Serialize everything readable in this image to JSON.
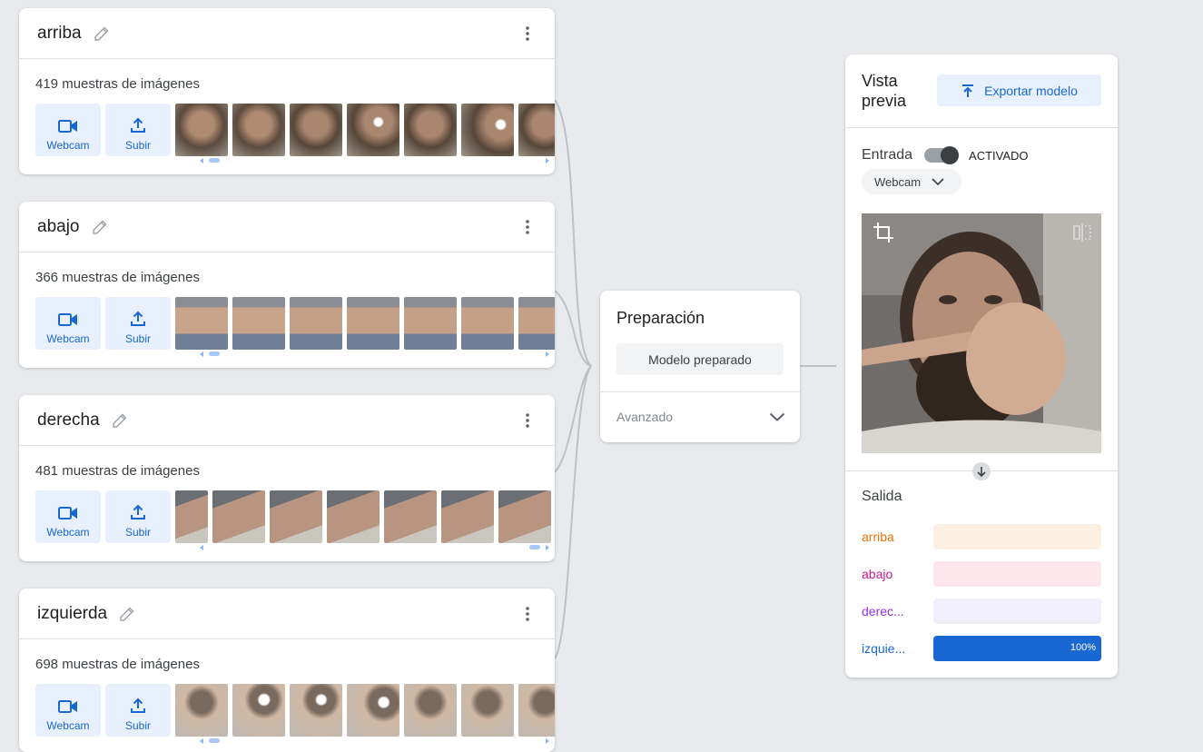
{
  "classes": [
    {
      "title": "arriba",
      "count_text": "419 muestras de imágenes",
      "webcam_label": "Webcam",
      "upload_label": "Subir",
      "scroll_fraction": 0
    },
    {
      "title": "abajo",
      "count_text": "366 muestras de imágenes",
      "webcam_label": "Webcam",
      "upload_label": "Subir",
      "scroll_fraction": 0
    },
    {
      "title": "derecha",
      "count_text": "481 muestras de imágenes",
      "webcam_label": "Webcam",
      "upload_label": "Subir",
      "scroll_fraction": 1
    },
    {
      "title": "izquierda",
      "count_text": "698 muestras de imágenes",
      "webcam_label": "Webcam",
      "upload_label": "Subir",
      "scroll_fraction": 0
    }
  ],
  "training": {
    "title": "Preparación",
    "button_label": "Modelo preparado",
    "advanced_label": "Avanzado"
  },
  "preview": {
    "title": "Vista previa",
    "export_label": "Exportar modelo",
    "input_label": "Entrada",
    "toggle_state": "ACTIVADO",
    "source_select": "Webcam",
    "output_label": "Salida",
    "outputs": [
      {
        "label": "arriba",
        "value": 0,
        "color": "#e8710a",
        "track": "#feefe3",
        "pct_text": ""
      },
      {
        "label": "abajo",
        "value": 0,
        "color": "#d01884",
        "track": "#fde7ec",
        "pct_text": ""
      },
      {
        "label": "derec...",
        "value": 0,
        "color": "#9334e6",
        "track": "#f1effc",
        "pct_text": ""
      },
      {
        "label": "izquie...",
        "value": 1.0,
        "color": "#1967d2",
        "track": "#e8f0fe",
        "pct_text": "100%"
      }
    ]
  },
  "icons": {
    "edit": "pencil-icon",
    "more": "more-vert-icon",
    "webcam": "videocam-icon",
    "upload": "upload-icon",
    "export": "upload-icon",
    "crop": "crop-icon",
    "flip": "flip-icon",
    "chevron": "chevron-down-icon",
    "arrow_down": "arrow-down-icon"
  }
}
